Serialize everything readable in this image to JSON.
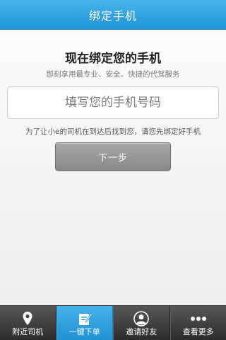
{
  "header": {
    "title": "绑定手机"
  },
  "main": {
    "headline": "现在绑定您的手机",
    "subline": "即刻享用最专业、安全、快捷的代驾服务",
    "phone_input": {
      "placeholder": "填写您的手机号码",
      "value": ""
    },
    "hint": "为了让小e的司机在到达后找到您，请您先绑定好手机",
    "next_button_label": "下一步"
  },
  "tabbar": {
    "active_index": 1,
    "tabs": [
      {
        "label": "附近司机",
        "icon": "location-pin-icon"
      },
      {
        "label": "一键下单",
        "icon": "edit-note-icon"
      },
      {
        "label": "邀请好友",
        "icon": "user-avatar-icon"
      },
      {
        "label": "查看更多",
        "icon": "more-dots-icon"
      }
    ]
  },
  "colors": {
    "brand_blue": "#2aa1e0",
    "tabbar_dark": "#3a3a3a",
    "button_gray": "#999999"
  }
}
